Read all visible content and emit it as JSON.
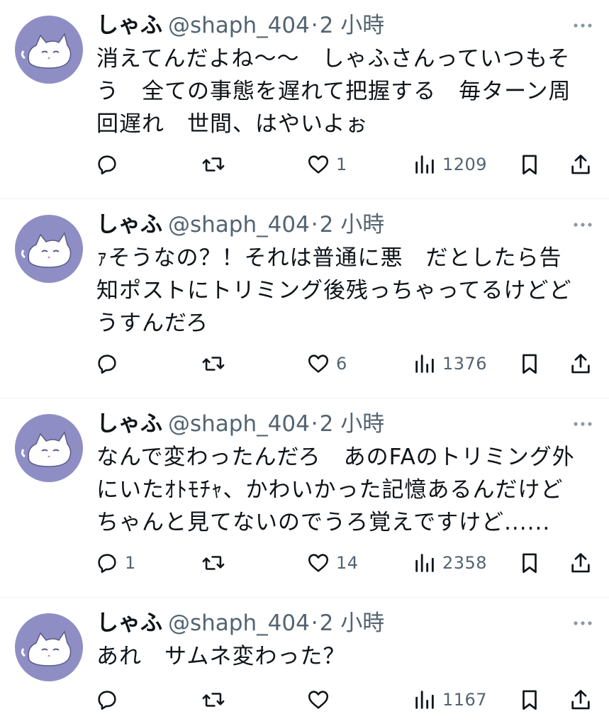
{
  "tweets": [
    {
      "name": "しゃふ",
      "handle": "@shaph_404",
      "separator": "·",
      "time": "2 小時",
      "lines": [
        "消えてんだよね～～　しゃふさんっていつもそ",
        "う　全ての事態を遅れて把握する　毎ターン周",
        "回遅れ　世間、はやいよぉ"
      ],
      "replies": "",
      "retweets": "",
      "likes": "1",
      "views": "1209"
    },
    {
      "name": "しゃふ",
      "handle": "@shaph_404",
      "separator": "·",
      "time": "2 小時",
      "lines": [
        "ｧそうなの？！それは普通に悪　だとしたら告",
        "知ポストにトリミング後残っちゃってるけどど",
        "うすんだろ"
      ],
      "replies": "",
      "retweets": "",
      "likes": "6",
      "views": "1376"
    },
    {
      "name": "しゃふ",
      "handle": "@shaph_404",
      "separator": "·",
      "time": "2 小時",
      "lines": [
        "なんで変わったんだろ　あのFAのトリミング外",
        "にいたｵﾄﾓﾁｬ、かわいかった記憶あるんだけど",
        "ちゃんと見てないのでうろ覚えですけど......"
      ],
      "replies": "1",
      "retweets": "",
      "likes": "14",
      "views": "2358"
    },
    {
      "name": "しゃふ",
      "handle": "@shaph_404",
      "separator": "·",
      "time": "2 小時",
      "lines": [
        "あれ　サムネ変わった？"
      ],
      "replies": "",
      "retweets": "",
      "likes": "",
      "views": "1167"
    }
  ],
  "icons": {
    "reply": "reply-icon",
    "retweet": "retweet-icon",
    "like": "heart-icon",
    "views": "views-chart-icon",
    "bookmark": "bookmark-icon",
    "share": "share-icon",
    "more": "more-dots-icon"
  },
  "colors": {
    "text": "#0f1419",
    "secondary": "#536471",
    "avatar_bg": "#8f8ec4",
    "divider": "#eff3f4"
  }
}
